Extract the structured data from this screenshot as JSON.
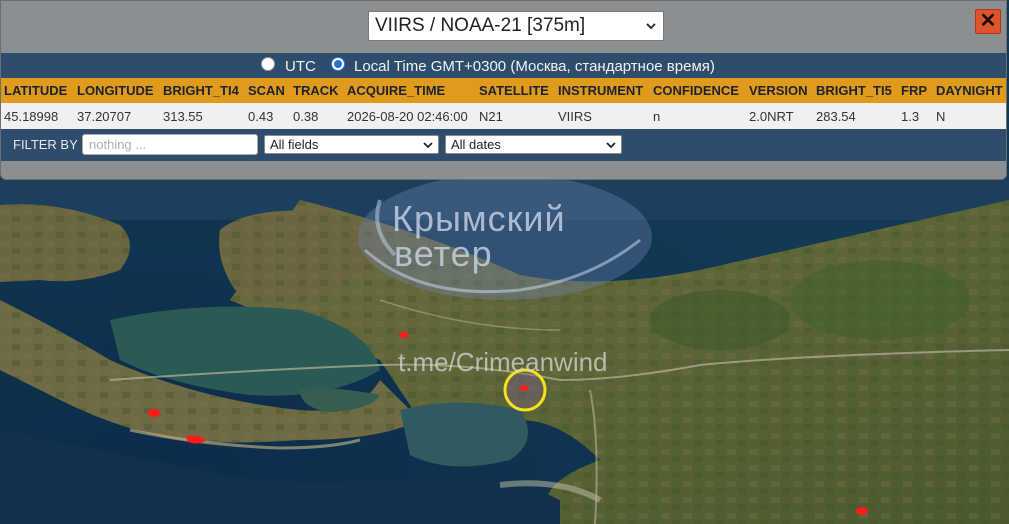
{
  "header": {
    "satellite_select": "VIIRS / NOAA-21 [375m]",
    "close_label": "✕"
  },
  "timezone": {
    "utc_label": "UTC",
    "local_label": "Local Time GMT+0300 (Москва, стандартное время)",
    "selected": "local"
  },
  "table": {
    "columns": [
      "LATITUDE",
      "LONGITUDE",
      "BRIGHT_TI4",
      "SCAN",
      "TRACK",
      "ACQUIRE_TIME",
      "SATELLITE",
      "INSTRUMENT",
      "CONFIDENCE",
      "VERSION",
      "BRIGHT_TI5",
      "FRP",
      "DAYNIGHT"
    ],
    "rows": [
      [
        "45.18998",
        "37.20707",
        "313.55",
        "0.43",
        "0.38",
        "2026-08-20 02:46:00",
        "N21",
        "VIIRS",
        "n",
        "2.0NRT",
        "283.54",
        "1.3",
        "N"
      ]
    ]
  },
  "filter": {
    "label": "FILTER BY",
    "input_placeholder": "nothing ...",
    "field_select": "All fields",
    "date_select": "All dates"
  },
  "watermark": {
    "line1": "Крымский",
    "line2": "ветер",
    "url": "t.me/Crimeanwind"
  },
  "map": {
    "fire_color": "#ff1a1a",
    "highlight_ring_color": "#f3e318"
  }
}
